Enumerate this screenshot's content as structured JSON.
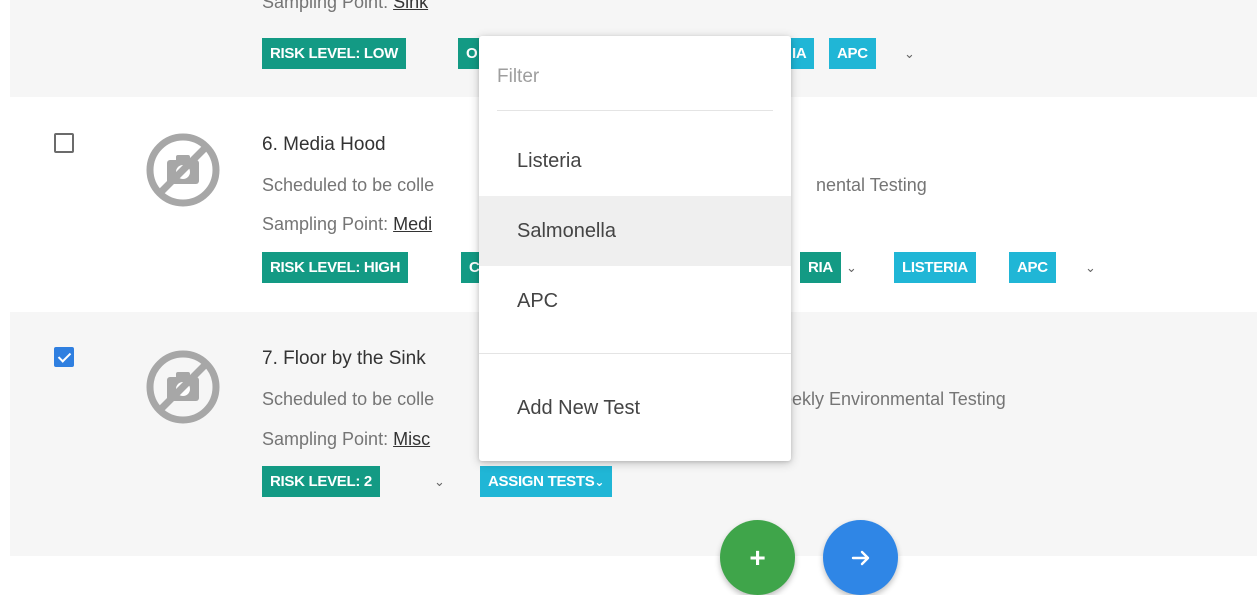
{
  "rows": [
    {
      "sampling_label": "Sampling Point:",
      "sampling_value": "Sink",
      "tags": [
        "RISK LEVEL: LOW",
        "O",
        "IA",
        "APC"
      ]
    },
    {
      "title": "6. Media Hood",
      "scheduled": "Scheduled to be colle",
      "schedule_suffix": "nental Testing",
      "sampling_label": "Sampling Point:",
      "sampling_value": "Medi",
      "tags": [
        "RISK LEVEL: HIGH",
        "C",
        "RIA",
        "LISTERIA",
        "APC"
      ]
    },
    {
      "title": "7. Floor by the Sink",
      "scheduled": "Scheduled to be colle",
      "schedule_suffix": "eekly Environmental Testing",
      "sampling_label": "Sampling Point:",
      "sampling_value": "Misc",
      "tags": [
        "RISK LEVEL: 2",
        "ASSIGN TESTS"
      ],
      "checked": true
    }
  ],
  "menu": {
    "filter_placeholder": "Filter",
    "items": [
      "Listeria",
      "Salmonella",
      "APC"
    ],
    "highlighted": "Salmonella",
    "footer_item": "Add New Test"
  },
  "fabs": {
    "add": "+",
    "next": "→"
  },
  "colors": {
    "tag_green": "#139a84",
    "tag_cyan": "#20b6d6",
    "fab_green": "#3fa54a",
    "fab_blue": "#2f86e6",
    "checkbox_blue": "#2f7fe0"
  }
}
